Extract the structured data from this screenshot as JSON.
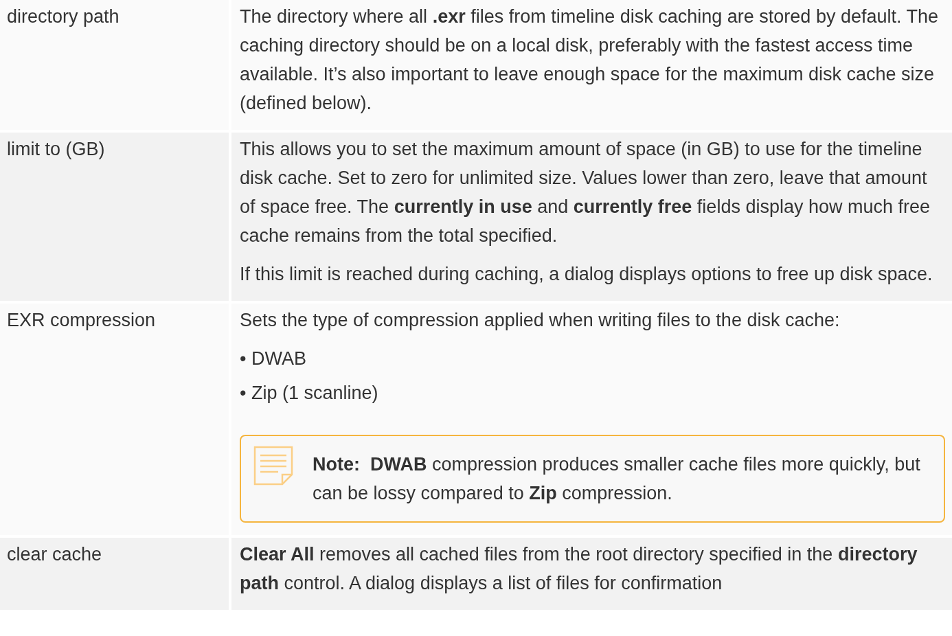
{
  "rows": [
    {
      "label": "directory path",
      "blocks": [
        {
          "kind": "paragraph",
          "text": "The directory where all **.exr** files from timeline disk caching are stored by default. The caching directory should be on a local disk, preferably with the fastest access time available. It’s also important to leave enough space for the maximum disk cache size (defined below)."
        }
      ]
    },
    {
      "label": "limit to (GB)",
      "blocks": [
        {
          "kind": "paragraph",
          "text": "This allows you to set the maximum amount of space (in GB) to use for the timeline disk cache. Set to zero for unlimited size. Values lower than zero, leave that amount of space free. The **currently in use** and **currently free** fields display how much free cache remains from the total specified."
        },
        {
          "kind": "paragraph",
          "text": "If this limit is reached during caching, a dialog displays options to free up disk space."
        }
      ]
    },
    {
      "label": "EXR compression",
      "blocks": [
        {
          "kind": "paragraph",
          "text": "Sets the type of compression applied when writing files to the disk cache:"
        },
        {
          "kind": "bullet",
          "marker": "•",
          "text": "DWAB"
        },
        {
          "kind": "bullet",
          "marker": "•",
          "text": "Zip (1 scanline)"
        },
        {
          "kind": "note",
          "title": "Note:",
          "text": "**DWAB** compression produces smaller cache files more quickly, but can be lossy compared to **Zip** compression."
        }
      ]
    },
    {
      "label": "clear cache",
      "blocks": [
        {
          "kind": "paragraph",
          "text": "**Clear All** removes all cached files from the root directory specified in the **directory path** control. A dialog displays a list of files for confirmation"
        }
      ]
    }
  ]
}
